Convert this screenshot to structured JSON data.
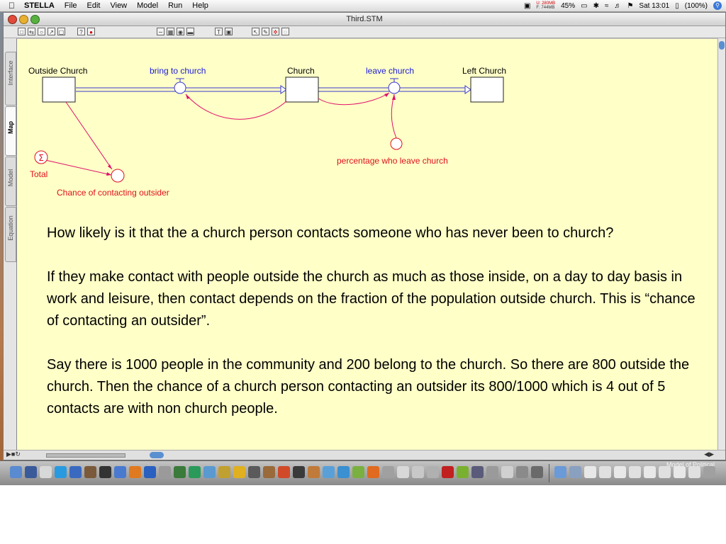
{
  "menubar": {
    "apple": "",
    "app": "STELLA",
    "items": [
      "File",
      "Edit",
      "View",
      "Model",
      "Run",
      "Help"
    ],
    "status": {
      "mem_u_label": "U:",
      "mem_u": "280MB",
      "mem_f_label": "F:",
      "mem_f": "744MB",
      "cpu": "45%",
      "clock": "Sat 13:01",
      "battery": "(100%)"
    }
  },
  "window": {
    "title": "Third.STM"
  },
  "side_tabs": [
    "Interface",
    "Map",
    "Model",
    "Equation"
  ],
  "model": {
    "stocks": {
      "outside": "Outside Church",
      "church": "Church",
      "left": "Left Church"
    },
    "flows": {
      "bring": "bring to church",
      "leave": "leave church"
    },
    "converters": {
      "percentage": "percentage who leave church",
      "total": "Total",
      "total_symbol": "Σ",
      "chance": "Chance of contacting outsider"
    },
    "colors": {
      "flow_label": "#1a1ad8",
      "converter_label": "#e0101c",
      "connector": "#e0106a",
      "stock_border": "#222222",
      "pipe": "#3a3ad0",
      "canvas": "#ffffc8"
    }
  },
  "text": {
    "p1": "How likely is it that the a church person contacts someone who has never been to church?",
    "p2": "If they make contact with people outside the church as much as those inside, on a day to day basis in work and leisure, then contact  depends on the fraction of the population outside church. This is “chance of contacting an outsider”.",
    "p3": "Say there is 1000 people in the community and 200 belong to the church. So there are 800 outside the church.  Then the chance of a church person contacting an outsider its 800/1000 which is 4 out of 5 contacts are with non church people."
  },
  "dock": {
    "caption": "Model of Political"
  }
}
